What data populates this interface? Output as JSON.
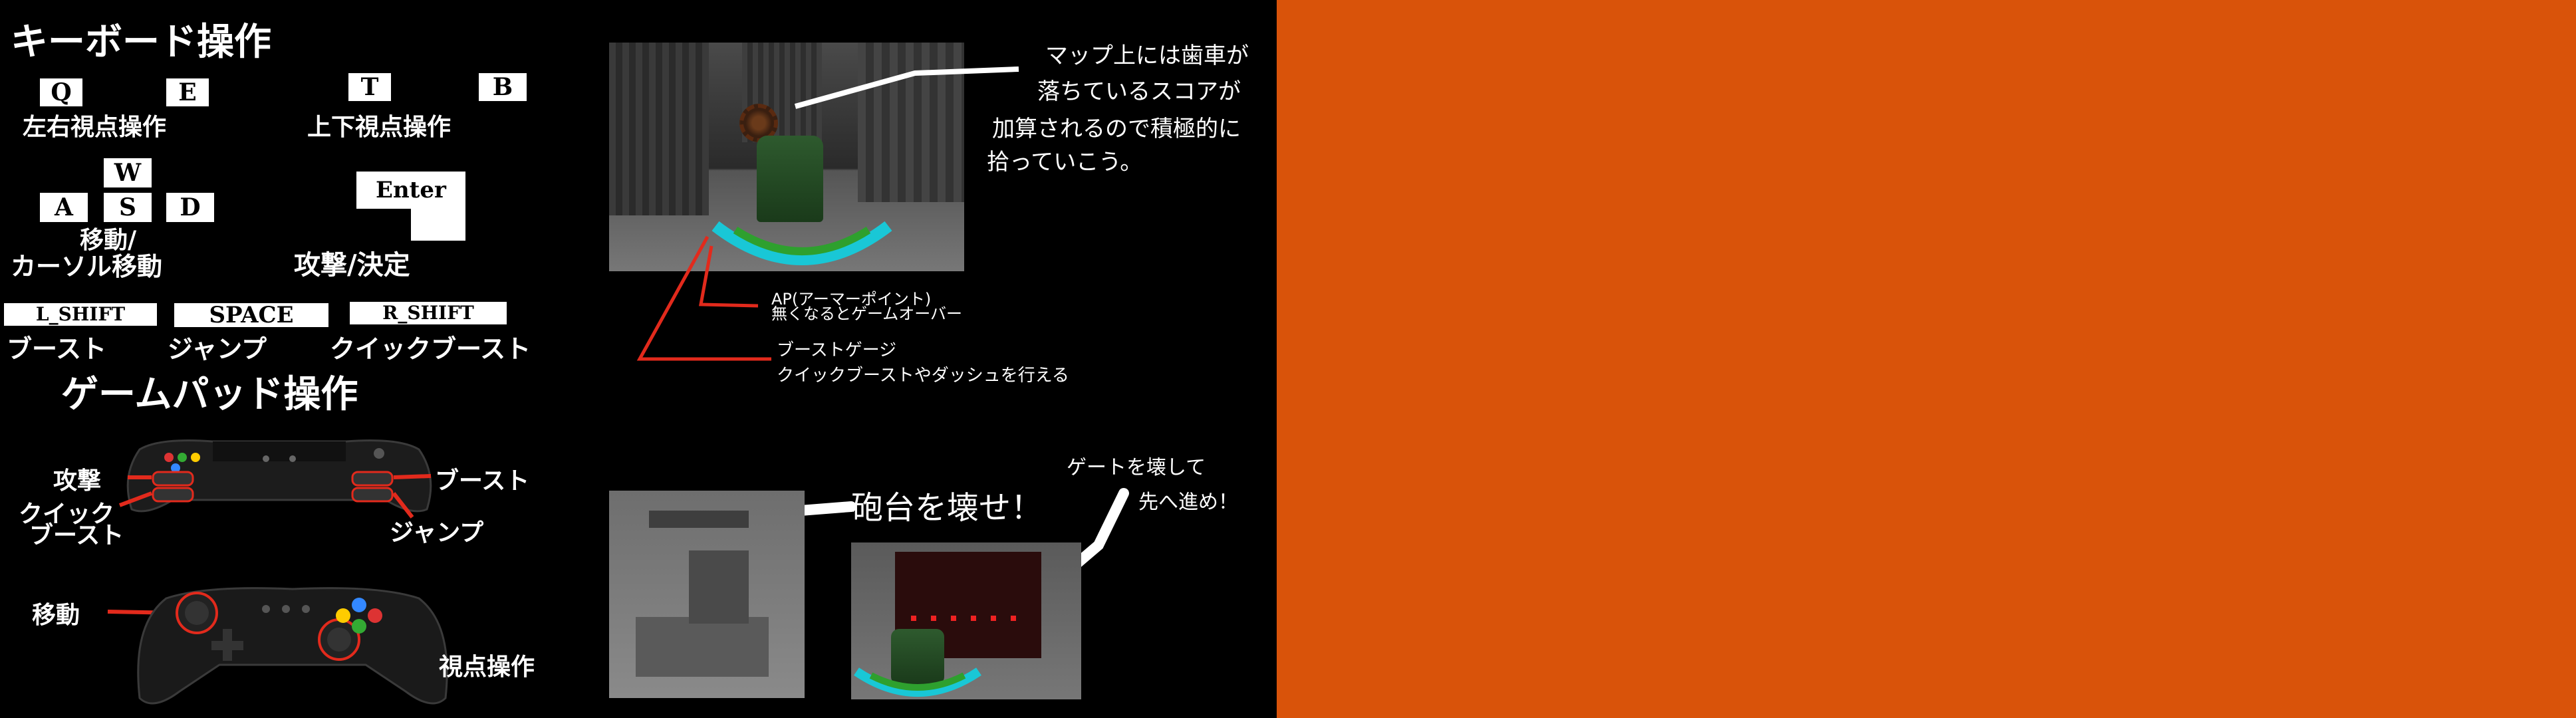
{
  "colors": {
    "background": "#d9530a",
    "panel": "#000000",
    "callout_line": "#e22a1c",
    "text": "#ffffff"
  },
  "keyboard": {
    "title": "キーボード操作",
    "keys": {
      "q": "Q",
      "e": "E",
      "t": "T",
      "b": "B",
      "w": "W",
      "a": "A",
      "s": "S",
      "d": "D",
      "enter": "Enter",
      "lshift": "L_SHIFT",
      "space": "SPACE",
      "rshift": "R_SHIFT"
    },
    "labels": {
      "lr_view": "左右視点操作",
      "ud_view": "上下視点操作",
      "move_line1": "移動/",
      "move_line2": "カーソル移動",
      "attack": "攻撃/決定",
      "boost": "ブースト",
      "jump": "ジャンプ",
      "quick_boost": "クイックブースト"
    }
  },
  "gamepad": {
    "title": "ゲームパッド操作",
    "labels": {
      "attack": "攻撃",
      "quick_line1": "クイック",
      "quick_line2": "ブースト",
      "boost": "ブースト",
      "jump": "ジャンプ",
      "move": "移動",
      "view": "視点操作"
    }
  },
  "notes": {
    "gear_line1": "マップ上には歯車が",
    "gear_line2": "落ちているスコアが",
    "gear_line3": "加算されるので積極的に",
    "gear_line4": "拾っていこう。",
    "ap_line1": "AP(アーマーポイント)",
    "ap_line2": "無くなるとゲームオーバー",
    "boost_line1": "ブーストゲージ",
    "boost_line2": "クイックブーストやダッシュを行える",
    "turret": "砲台を壊せ！",
    "gate_line1": "ゲートを壊して",
    "gate_line2": "先へ進め！"
  }
}
